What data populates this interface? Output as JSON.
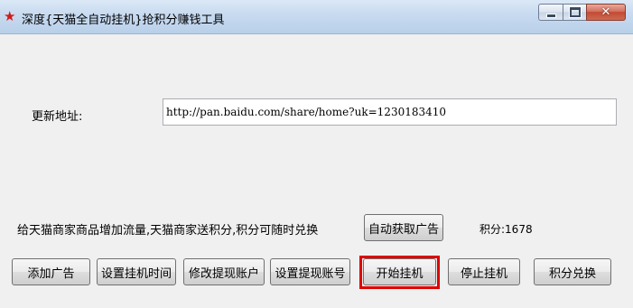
{
  "window": {
    "title": "深度{天猫全自动挂机}抢积分赚钱工具",
    "icon": "red-star-icon"
  },
  "form": {
    "update_label": "更新地址:",
    "update_url": "http://pan.baidu.com/share/home?uk=1230183410"
  },
  "info": {
    "description": "给天猫商家商品增加流量,天猫商家送积分,积分可随时兑换",
    "points_label": "积分:",
    "points_value": "1678",
    "auto_ad_button": "自动获取广告"
  },
  "buttons": {
    "add_ad": "添加广告",
    "set_time": "设置挂机时间",
    "modify_account": "修改提现账户",
    "set_account_no": "设置提现账号",
    "start": "开始挂机",
    "stop": "停止挂机",
    "redeem": "积分兑换"
  },
  "colors": {
    "highlight": "#e00000",
    "accent": "#d21a1a"
  }
}
